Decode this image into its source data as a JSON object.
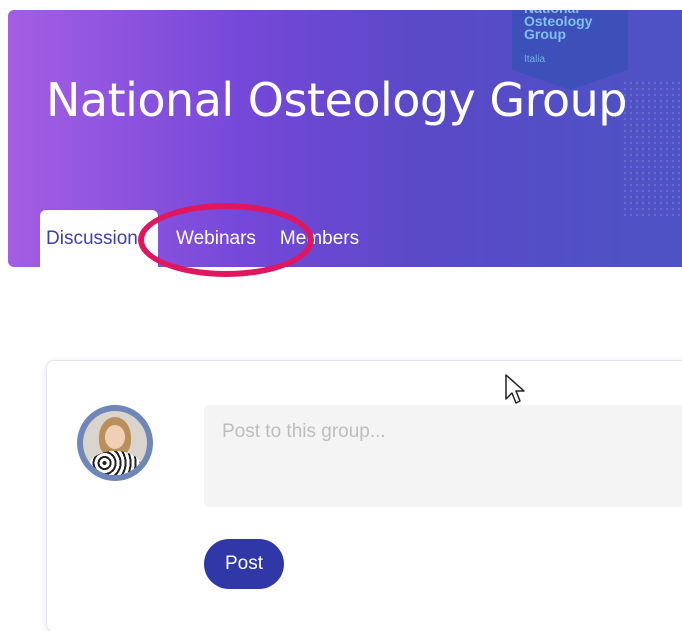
{
  "group": {
    "title": "National Osteology Group",
    "logo_lines": "National\nOsteology\nGroup",
    "logo_sub": "Italia"
  },
  "tabs": [
    {
      "label": "Discussion",
      "active": true
    },
    {
      "label": "Webinars",
      "active": false
    },
    {
      "label": "Members",
      "active": false
    }
  ],
  "composer": {
    "placeholder": "Post to this group...",
    "post_label": "Post"
  },
  "colors": {
    "accent": "#3038a8",
    "highlight": "#e0165e"
  },
  "icons": {
    "cursor": "mouse-pointer-icon"
  }
}
